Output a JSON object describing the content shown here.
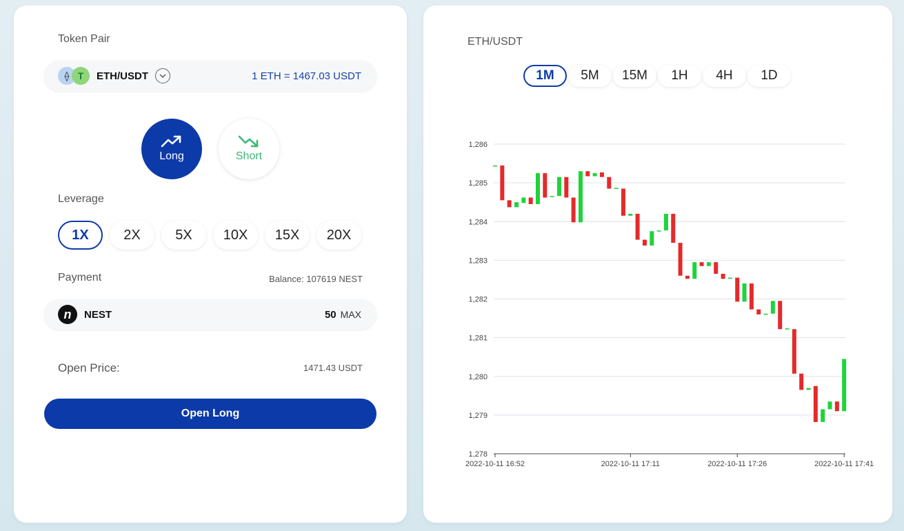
{
  "left": {
    "token_pair_label": "Token Pair",
    "pair": {
      "eth_glyph": "⟠",
      "usdt_glyph": "T",
      "name": "ETH/USDT",
      "rate": "1 ETH = 1467.03 USDT"
    },
    "long_label": "Long",
    "short_label": "Short",
    "leverage_label": "Leverage",
    "leverage_options": [
      "1X",
      "2X",
      "5X",
      "10X",
      "15X",
      "20X"
    ],
    "payment_label": "Payment",
    "balance": "Balance: 107619 NEST",
    "payment": {
      "logo_glyph": "n",
      "token": "NEST",
      "amount": "50",
      "max_label": "MAX"
    },
    "open_price_label": "Open Price:",
    "open_price_value": "1471.43 USDT",
    "open_button": "Open Long"
  },
  "right": {
    "title": "ETH/USDT",
    "intervals": [
      "1M",
      "5M",
      "15M",
      "1H",
      "4H",
      "1D"
    ]
  },
  "colors": {
    "accent": "#0d3aa9",
    "up": "#1fd33a",
    "down": "#e52a2a",
    "short": "#3cb777"
  },
  "chart_data": {
    "type": "candlestick",
    "ylim": [
      1278,
      1286
    ],
    "yticks": [
      "1,278",
      "1,279",
      "1,280",
      "1,281",
      "1,282",
      "1,283",
      "1,284",
      "1,285",
      "1,286"
    ],
    "xticks": [
      {
        "t": 0,
        "label": "2022-10-11 16:52"
      },
      {
        "t": 19,
        "label": "2022-10-11 17:11"
      },
      {
        "t": 34,
        "label": "2022-10-11 17:26"
      },
      {
        "t": 49,
        "label": "2022-10-11 17:41"
      }
    ],
    "candles": [
      {
        "t": 0,
        "o": 1285.45,
        "c": 1285.45
      },
      {
        "t": 1,
        "o": 1285.45,
        "c": 1284.55
      },
      {
        "t": 2,
        "o": 1284.55,
        "c": 1284.37
      },
      {
        "t": 3,
        "o": 1284.37,
        "c": 1284.5
      },
      {
        "t": 4,
        "o": 1284.48,
        "c": 1284.62
      },
      {
        "t": 5,
        "o": 1284.62,
        "c": 1284.45
      },
      {
        "t": 6,
        "o": 1284.45,
        "c": 1285.25
      },
      {
        "t": 7,
        "o": 1285.25,
        "c": 1284.62
      },
      {
        "t": 8,
        "o": 1284.64,
        "c": 1284.66
      },
      {
        "t": 9,
        "o": 1284.66,
        "c": 1285.15
      },
      {
        "t": 10,
        "o": 1285.15,
        "c": 1284.62
      },
      {
        "t": 11,
        "o": 1284.62,
        "c": 1283.98
      },
      {
        "t": 12,
        "o": 1283.98,
        "c": 1285.3
      },
      {
        "t": 13,
        "o": 1285.3,
        "c": 1285.17
      },
      {
        "t": 14,
        "o": 1285.17,
        "c": 1285.25
      },
      {
        "t": 15,
        "o": 1285.27,
        "c": 1285.15
      },
      {
        "t": 16,
        "o": 1285.15,
        "c": 1284.85
      },
      {
        "t": 17,
        "o": 1284.85,
        "c": 1284.87
      },
      {
        "t": 18,
        "o": 1284.85,
        "c": 1284.15
      },
      {
        "t": 19,
        "o": 1284.15,
        "c": 1284.2
      },
      {
        "t": 20,
        "o": 1284.2,
        "c": 1283.53
      },
      {
        "t": 21,
        "o": 1283.53,
        "c": 1283.38
      },
      {
        "t": 22,
        "o": 1283.38,
        "c": 1283.75
      },
      {
        "t": 23,
        "o": 1283.75,
        "c": 1283.77
      },
      {
        "t": 24,
        "o": 1283.77,
        "c": 1284.2
      },
      {
        "t": 25,
        "o": 1284.2,
        "c": 1283.45
      },
      {
        "t": 26,
        "o": 1283.45,
        "c": 1282.6
      },
      {
        "t": 27,
        "o": 1282.6,
        "c": 1282.52
      },
      {
        "t": 28,
        "o": 1282.52,
        "c": 1282.95
      },
      {
        "t": 29,
        "o": 1282.95,
        "c": 1282.85
      },
      {
        "t": 30,
        "o": 1282.85,
        "c": 1282.95
      },
      {
        "t": 31,
        "o": 1282.95,
        "c": 1282.65
      },
      {
        "t": 32,
        "o": 1282.65,
        "c": 1282.52
      },
      {
        "t": 33,
        "o": 1282.52,
        "c": 1282.55
      },
      {
        "t": 34,
        "o": 1282.55,
        "c": 1281.93
      },
      {
        "t": 35,
        "o": 1281.93,
        "c": 1282.4
      },
      {
        "t": 36,
        "o": 1282.4,
        "c": 1281.73
      },
      {
        "t": 37,
        "o": 1281.73,
        "c": 1281.6
      },
      {
        "t": 38,
        "o": 1281.6,
        "c": 1281.62
      },
      {
        "t": 39,
        "o": 1281.62,
        "c": 1281.95
      },
      {
        "t": 40,
        "o": 1281.95,
        "c": 1281.22
      },
      {
        "t": 41,
        "o": 1281.22,
        "c": 1281.24
      },
      {
        "t": 42,
        "o": 1281.22,
        "c": 1280.07
      },
      {
        "t": 43,
        "o": 1280.07,
        "c": 1279.65
      },
      {
        "t": 44,
        "o": 1279.65,
        "c": 1279.7
      },
      {
        "t": 45,
        "o": 1279.75,
        "c": 1278.82
      },
      {
        "t": 46,
        "o": 1278.82,
        "c": 1279.15
      },
      {
        "t": 47,
        "o": 1279.15,
        "c": 1279.35
      },
      {
        "t": 48,
        "o": 1279.35,
        "c": 1279.1
      },
      {
        "t": 49,
        "o": 1279.1,
        "c": 1280.45
      }
    ]
  }
}
